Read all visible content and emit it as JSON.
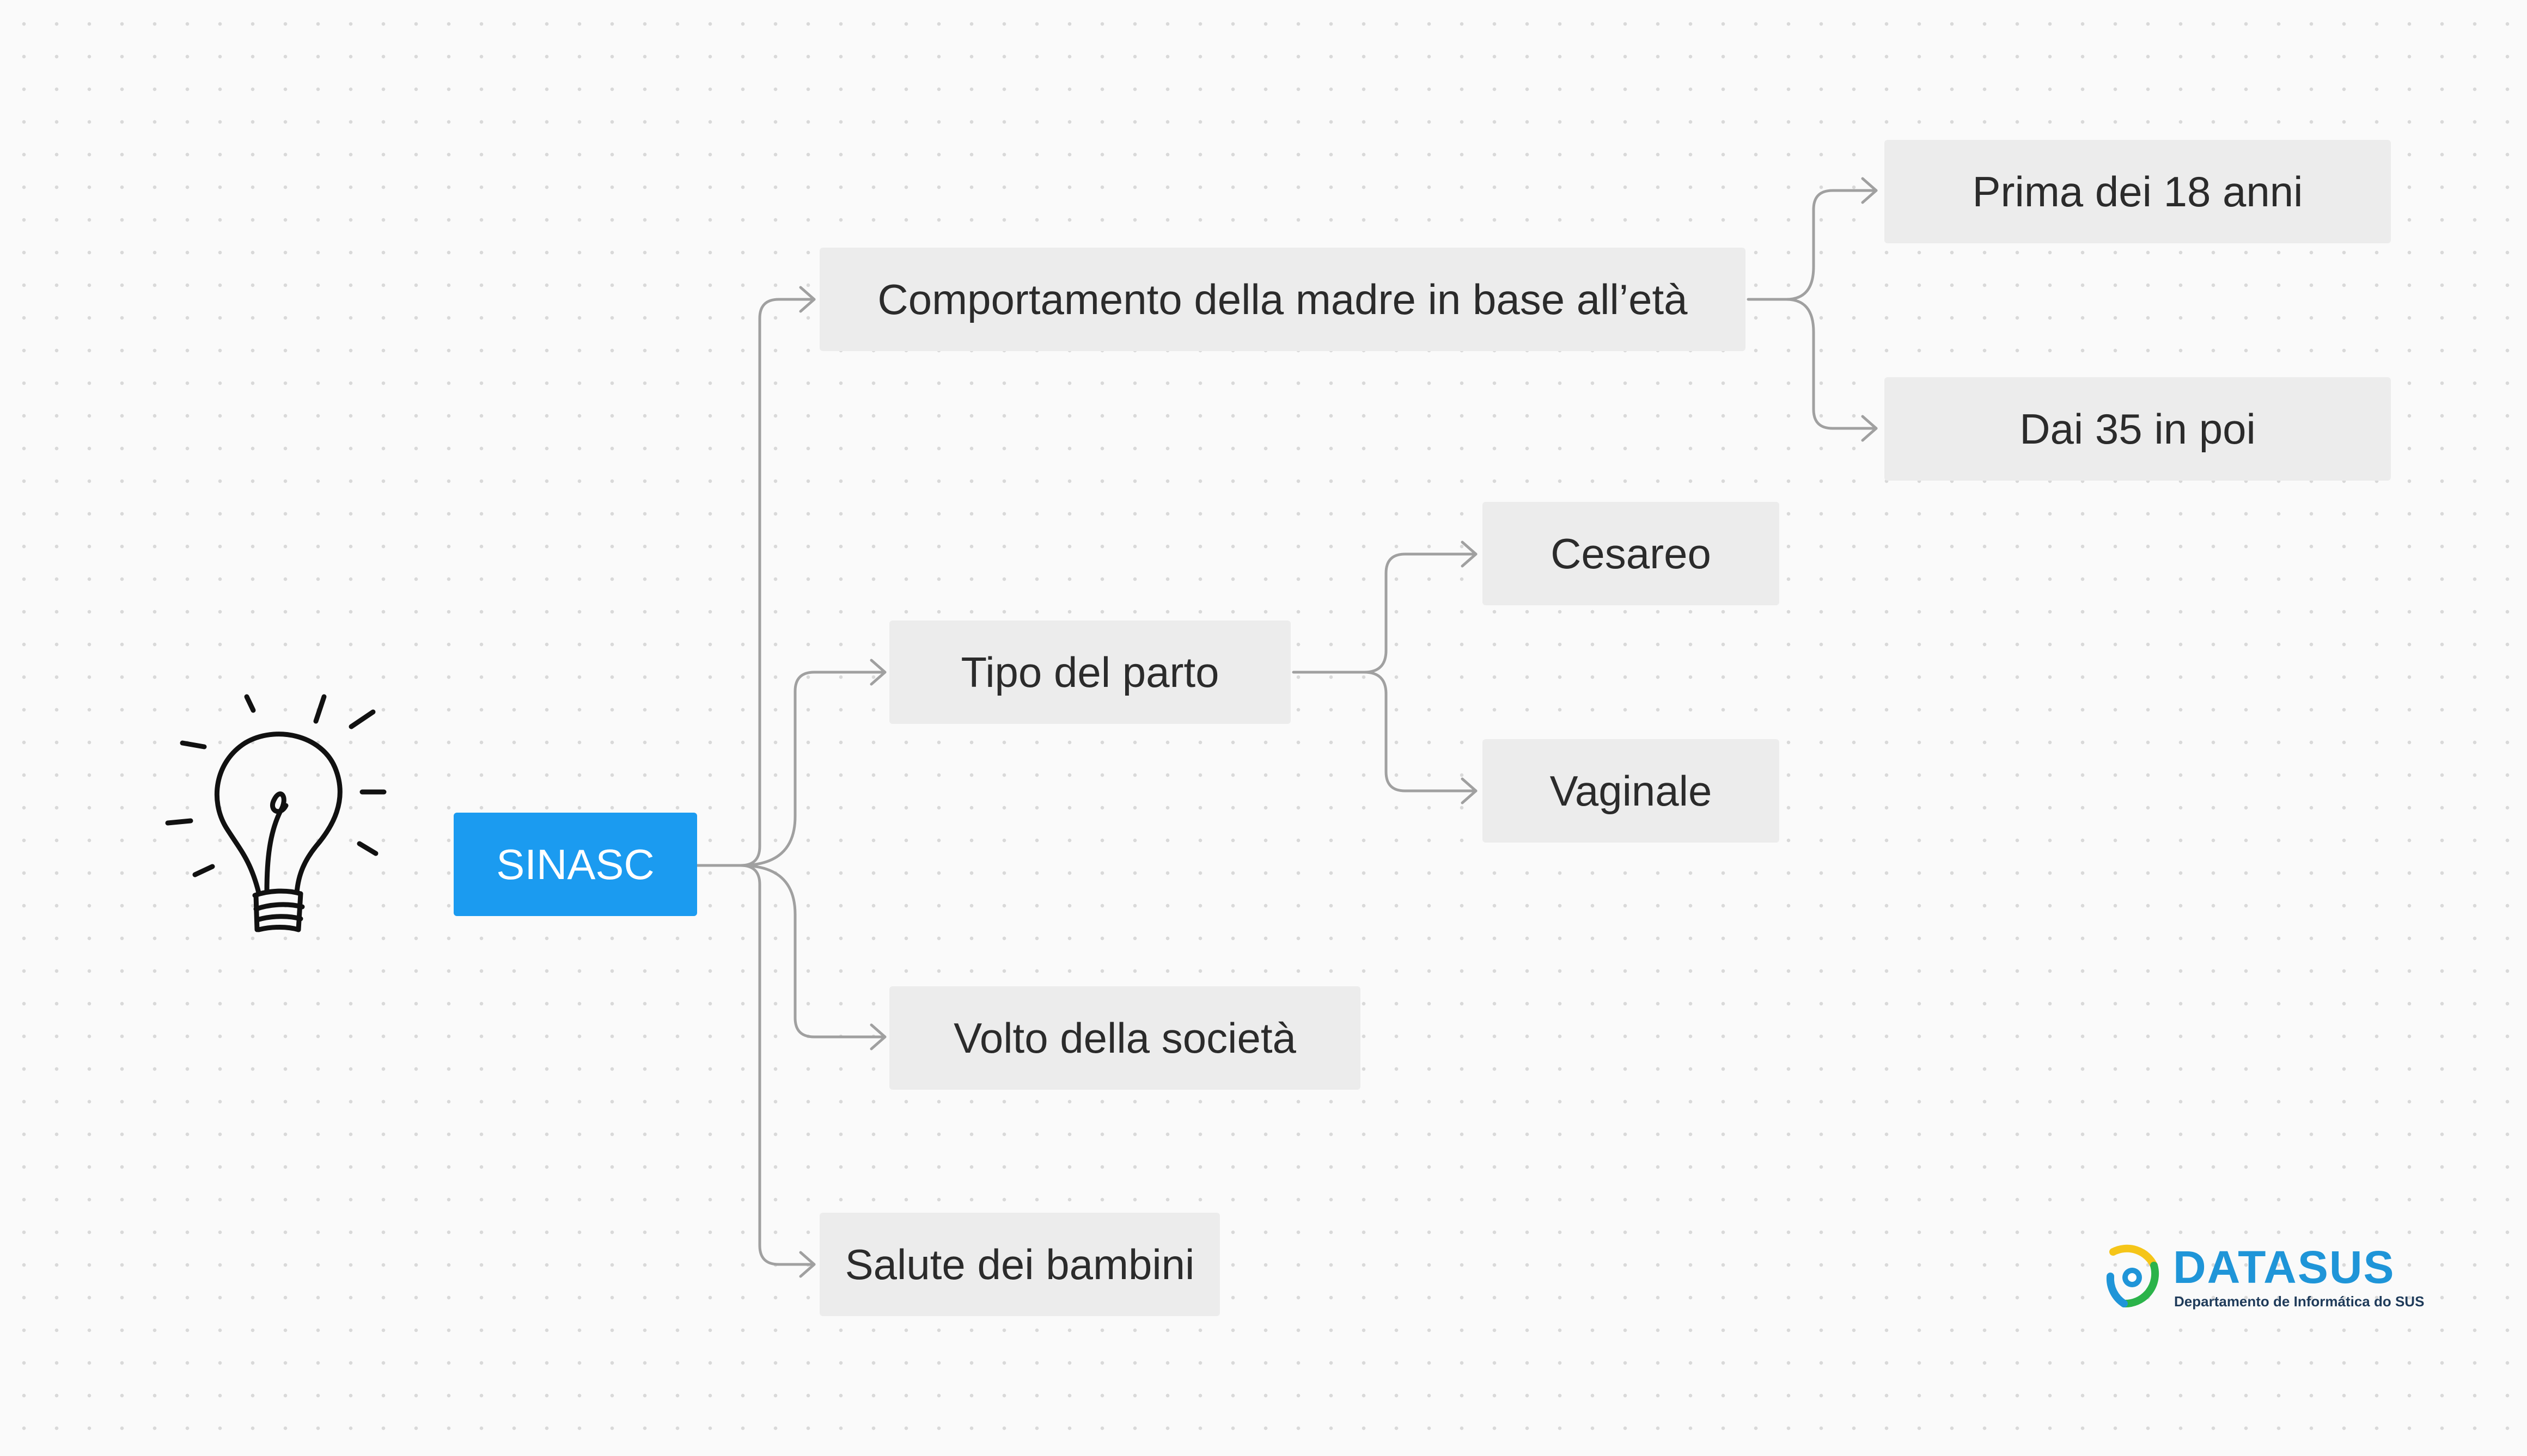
{
  "root": {
    "label": "SINASC"
  },
  "branches": [
    {
      "label": "Comportamento della madre in base all’età",
      "children": [
        {
          "label": "Prima dei 18 anni"
        },
        {
          "label": "Dai 35 in poi"
        }
      ]
    },
    {
      "label": "Tipo del parto",
      "children": [
        {
          "label": "Cesareo"
        },
        {
          "label": "Vaginale"
        }
      ]
    },
    {
      "label": "Volto della società"
    },
    {
      "label": "Salute dei bambini"
    }
  ],
  "logo": {
    "title": "DATASUS",
    "subtitle": "Departamento de Informática do SUS"
  },
  "icons": {
    "idea": "lightbulb-icon",
    "logo": "datasus-logo-icon"
  },
  "colors": {
    "root_fill": "#1b9bf0",
    "node_fill": "#ececec",
    "connector": "#a0a0a0",
    "logo_blue": "#1f95d8",
    "logo_yellow": "#f5c518",
    "logo_green": "#2bb34a"
  }
}
